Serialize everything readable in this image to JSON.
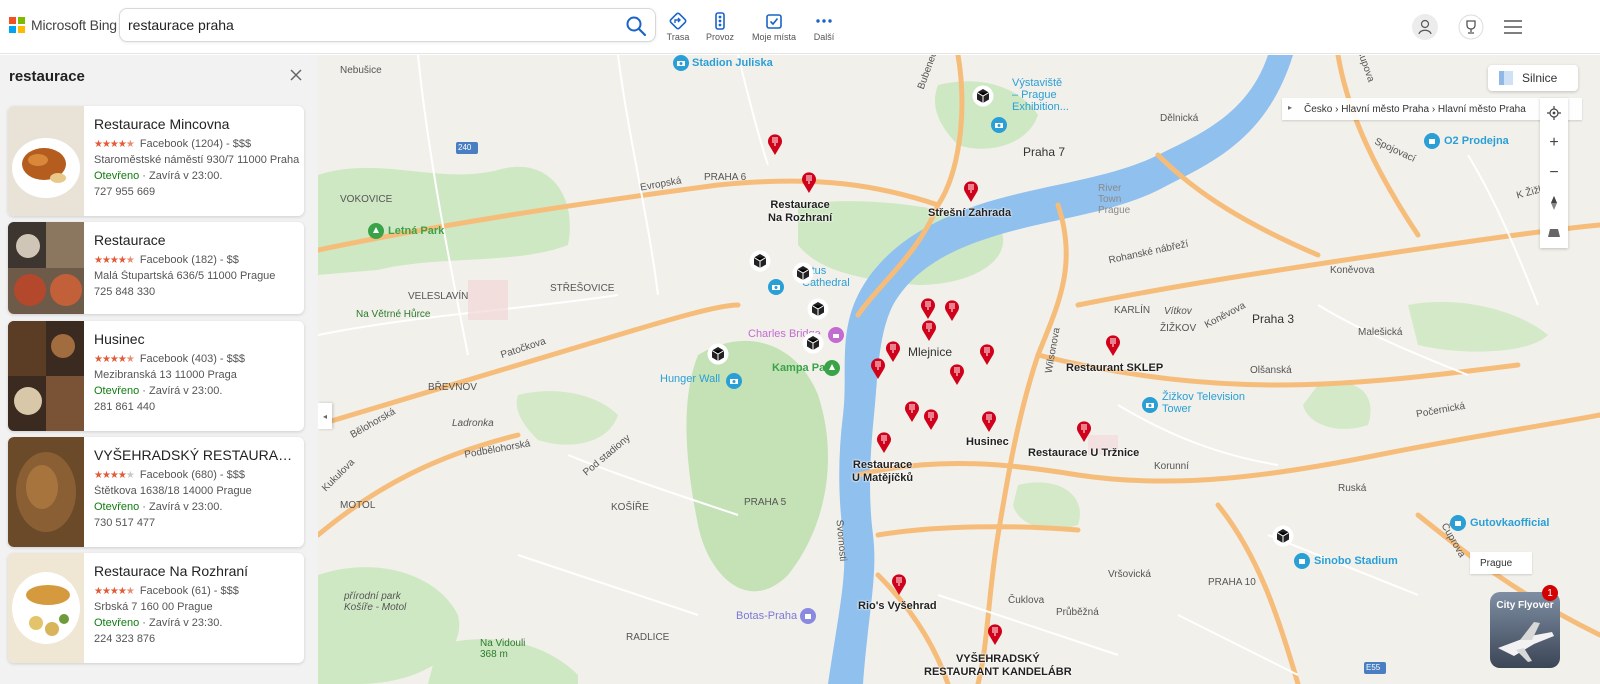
{
  "header": {
    "brand": "Microsoft Bing",
    "search_value": "restaurace praha",
    "tools": [
      {
        "label": "Trasa",
        "icon": "directions-icon"
      },
      {
        "label": "Provoz",
        "icon": "traffic-icon"
      },
      {
        "label": "Moje místa",
        "icon": "my-places-icon"
      },
      {
        "label": "Další",
        "icon": "more-icon"
      }
    ]
  },
  "panel": {
    "title": "restaurace",
    "results": [
      {
        "name": "Restaurace Mincovna",
        "rating": 4.5,
        "reviews": "Facebook (1204) - $$$",
        "address": "Staroměstské náměstí 930/7 11000 Praha",
        "status": "Otevřeno",
        "hours": " · Zavírá v 23:00.",
        "phone": "727 955 669"
      },
      {
        "name": "Restaurace",
        "rating": 4.5,
        "reviews": "Facebook (182) - $$",
        "address": "Malá Štupartská 636/5 11000 Prague",
        "status": "",
        "hours": "",
        "phone": "725 848 330"
      },
      {
        "name": "Husinec",
        "rating": 4.5,
        "reviews": "Facebook (403) - $$$",
        "address": "Mezibranská 13 11000 Praga",
        "status": "Otevřeno",
        "hours": " · Zavírá v 23:00.",
        "phone": "281 861 440"
      },
      {
        "name": "VYŠEHRADSKÝ RESTAURANT ...",
        "rating": 4.0,
        "reviews": "Facebook (680) - $$$",
        "address": "Štětkova 1638/18 14000 Prague",
        "status": "Otevřeno",
        "hours": " · Zavírá v 23:00.",
        "phone": "730 517 477"
      },
      {
        "name": "Restaurace Na Rozhraní",
        "rating": 4.5,
        "reviews": "Facebook (61) - $$$",
        "address": "Srbská 7 160 00 Prague",
        "status": "Otevřeno",
        "hours": " · Zavírá v 23:30.",
        "phone": "224 323 876"
      }
    ]
  },
  "map": {
    "style_button": "Silnice",
    "breadcrumb": "Česko  ›  Hlavní město Praha  ›  Hlavní město Praha",
    "prague_tag": "Prague",
    "flyover_label": "City Flyover",
    "flyover_badge": "1",
    "labels": {
      "praha7": "Praha 7",
      "praha3": "Praha 3",
      "praha6": "PRAHA 6",
      "praha5": "PRAHA 5",
      "praha10": "PRAHA 10",
      "bubenec": "Bubeneč",
      "nebusice": "Nebušice",
      "vokovice": "VOKOVICE",
      "veleslavin": "VELESLAVÍN",
      "stresovice": "STŘEŠOVICE",
      "brevnov": "BŘEVNOV",
      "motol": "MOTOL",
      "kosire": "KOŠÍŘE",
      "radlice": "RADLICE",
      "karlin": "KARLÍN",
      "zizkov": "ŽIŽKOV",
      "vitkov": "Vítkov",
      "mlejnice": "Mlejnice",
      "evropska": "Evropská",
      "patockova": "Patočkova",
      "belohorska": "Bělohorská",
      "kukulova": "Kukulova",
      "ladronka": "Ladronka",
      "podbelohorska": "Podbělohorská",
      "pod_stadiony": "Pod stadiony",
      "wilsonova": "Wilsonova",
      "svornosti": "Svornosti",
      "rohanske": "Rohanské nábřeží",
      "konevova": "Koněvova",
      "konevova2": "Koněvova",
      "malesicka": "Malešická",
      "olsanska": "Olšanská",
      "pocernicka": "Počernická",
      "korunni": "Korunní",
      "ruska": "Ruská",
      "vrsovicka": "Vršovická",
      "ceskomalinska": "Čupova",
      "delnicka": "Dělnická",
      "spojovaci": "Spojovací",
      "k_zizkovu": "K Žižkovu",
      "jablonecka": "Čuprova",
      "cuklova": "Čuklova",
      "prazska": "Průběžná",
      "river_town": "River Town Prague",
      "na_vetrne": "Na Větrné Hůrce",
      "prirodni_park": "přírodní park\nKošíře - Motol",
      "na_vidouli": "Na Vidouli\n368 m",
      "road240": "240",
      "e55": "E55"
    },
    "pois": {
      "stadion": "Stadion Juliska",
      "vystaviste": "Výstaviště\n– Prague\nExhibition...",
      "o2": "O2 Prodejna",
      "letna": "Letná Park",
      "cathedral": "Vitus\nCathedral",
      "charles": "Charles Bridge",
      "kampa": "Kampa Park",
      "hunger": "Hunger Wall",
      "zizkov_tower": "Žižkov Television\nTower",
      "gutovka": "Gutovkaofficial",
      "sinobo": "Sinobo Stadium",
      "botas": "Botas-Praha"
    },
    "restaurants": {
      "na_rozhrani": "Restaurace\nNa Rozhraní",
      "stresni": "Střešní Zahrada",
      "sklep": "Restaurant SKLEP",
      "husinec": "Husinec",
      "matejicku": "Restaurace\nU Matějíčků",
      "trznice": "Restaurace U Tržnice",
      "rios": "Rio's Vyšehrad",
      "vysehradsky": "VYŠEHRADSKÝ\nRESTAURANT KANDELÁBR"
    },
    "colors": {
      "pin": "#d0021b",
      "poi": "#2a9fd6",
      "park": "#2c7a2c",
      "river": "#6aa9e8",
      "road": "#f5b26a"
    }
  }
}
